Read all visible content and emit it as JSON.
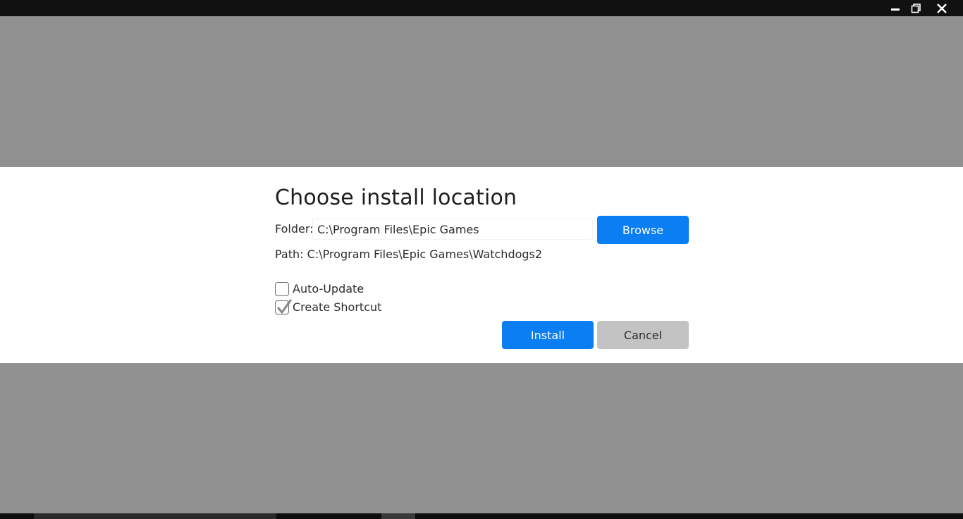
{
  "window": {
    "minimize_icon": "minimize-icon",
    "maximize_icon": "restore-icon",
    "close_icon": "close-icon"
  },
  "dialog": {
    "title": "Choose install location",
    "folder_label": "Folder:",
    "folder_value": "C:\\Program Files\\Epic Games",
    "browse_label": "Browse",
    "path_text": "Path: C:\\Program Files\\Epic Games\\Watchdogs2",
    "options": [
      {
        "label": "Auto-Update",
        "checked": false
      },
      {
        "label": "Create Shortcut",
        "checked": true
      }
    ],
    "install_label": "Install",
    "cancel_label": "Cancel"
  },
  "colors": {
    "backdrop": "#919191",
    "primary_button": "#0a7ef2",
    "secondary_button": "#c3c3c3",
    "titlebar": "#111111"
  }
}
